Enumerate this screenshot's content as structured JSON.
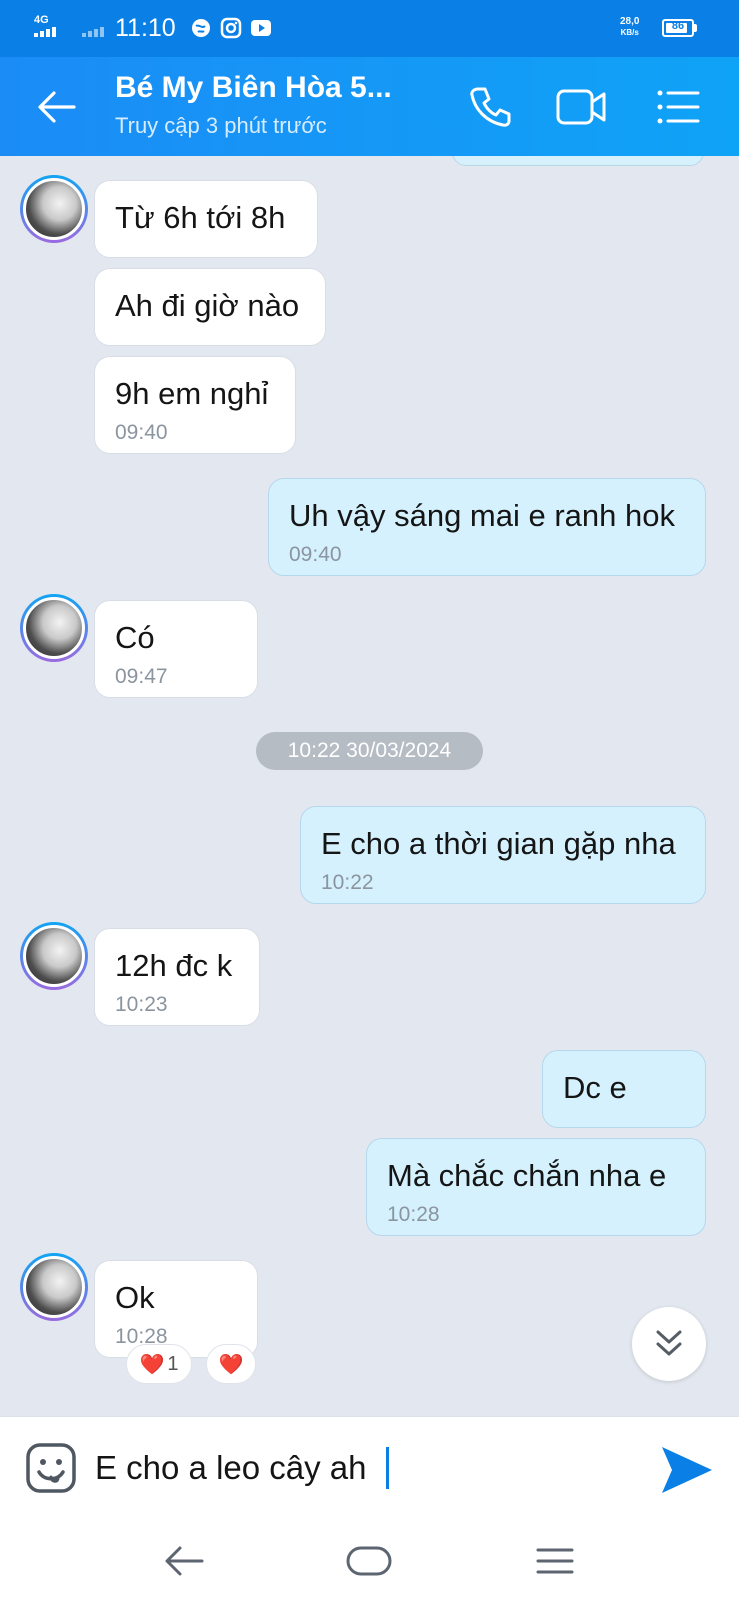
{
  "status_bar": {
    "network": "4G",
    "time": "11:10",
    "speed_value": "28,0",
    "speed_unit": "KB/s",
    "battery": "86",
    "battery_level": 0.86
  },
  "header": {
    "title": "Bé My Biên Hòa 5...",
    "subtitle": "Truy cập 3 phút trước",
    "icons": [
      "back-arrow-icon",
      "phone-icon",
      "video-call-icon",
      "menu-list-icon"
    ]
  },
  "chat": {
    "messages": [
      {
        "dir": "in",
        "text": "Từ 6h tới 8h",
        "time": ""
      },
      {
        "dir": "in",
        "text": "Ah đi giờ nào",
        "time": ""
      },
      {
        "dir": "in",
        "text": "9h em nghỉ",
        "time": "09:40"
      },
      {
        "dir": "out",
        "text": "Uh vậy sáng mai e ranh hok",
        "time": "09:40"
      },
      {
        "dir": "in",
        "text": "Có",
        "time": "09:47"
      },
      {
        "dir": "out",
        "text": "E cho a thời gian gặp nha",
        "time": "10:22"
      },
      {
        "dir": "in",
        "text": "12h đc k",
        "time": "10:23"
      },
      {
        "dir": "out",
        "text": "Dc e",
        "time": ""
      },
      {
        "dir": "out",
        "text": "Mà chắc chắn nha e",
        "time": "10:28"
      },
      {
        "dir": "in",
        "text": "Ok",
        "time": "10:28"
      }
    ],
    "date_separator": "10:22 30/03/2024",
    "reactions": [
      {
        "emoji": "❤️",
        "count": "1"
      },
      {
        "emoji": "❤️",
        "count": ""
      }
    ]
  },
  "composer": {
    "value": "E cho a leo cây ah",
    "icons": [
      "sticker-icon",
      "send-icon"
    ]
  },
  "nav_bar": {
    "icons": [
      "nav-back-icon",
      "nav-home-icon",
      "nav-menu-icon"
    ]
  },
  "colors": {
    "header": "#1b8cf6",
    "outgoing_bubble": "#d5f1fe",
    "incoming_bubble": "#ffffff",
    "chat_background": "#e3e8f0",
    "heart": "#e8102c",
    "send": "#0a7fe6"
  }
}
